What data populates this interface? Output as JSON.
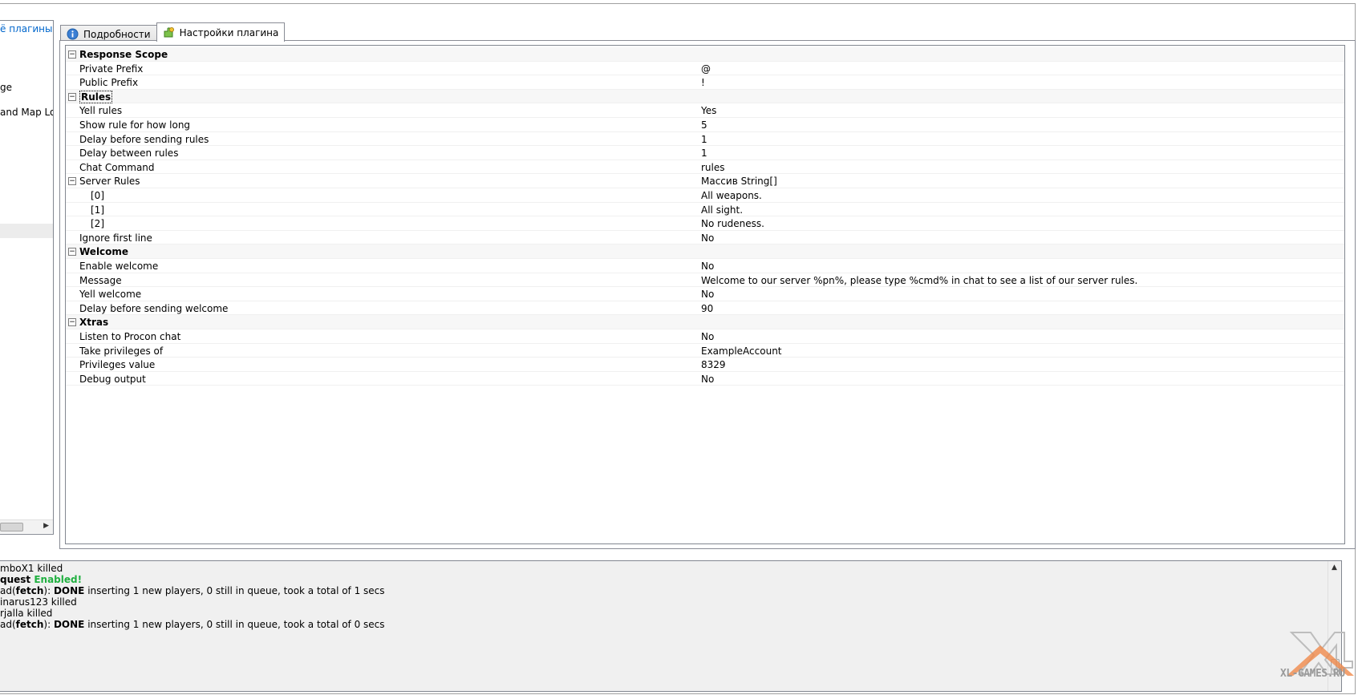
{
  "left_panel": {
    "link": "ё плагины",
    "items": [
      "ge",
      "and Map Lo"
    ]
  },
  "tabs": [
    {
      "label": "Подробности",
      "icon": "info-icon",
      "active": false
    },
    {
      "label": "Настройки плагина",
      "icon": "plugin-settings-icon",
      "active": true
    }
  ],
  "properties": {
    "rows": [
      {
        "type": "cat",
        "name": "Response Scope",
        "value": ""
      },
      {
        "type": "prop",
        "name": "Private Prefix",
        "value": "@"
      },
      {
        "type": "prop",
        "name": "Public Prefix",
        "value": "!"
      },
      {
        "type": "cat",
        "name": "Rules",
        "value": "",
        "focused": true
      },
      {
        "type": "prop",
        "name": "Yell rules",
        "value": "Yes"
      },
      {
        "type": "prop",
        "name": "Show rule for how long",
        "value": "5"
      },
      {
        "type": "prop",
        "name": "Delay before sending rules",
        "value": "1"
      },
      {
        "type": "prop",
        "name": "Delay between rules",
        "value": "1"
      },
      {
        "type": "prop",
        "name": "Chat Command",
        "value": "rules"
      },
      {
        "type": "expand",
        "name": "Server Rules",
        "value": "Массив String[]"
      },
      {
        "type": "child",
        "name": "[0]",
        "value": "All weapons."
      },
      {
        "type": "child",
        "name": "[1]",
        "value": "All sight."
      },
      {
        "type": "child",
        "name": "[2]",
        "value": "No rudeness."
      },
      {
        "type": "prop",
        "name": "Ignore first line",
        "value": "No"
      },
      {
        "type": "cat",
        "name": "Welcome",
        "value": ""
      },
      {
        "type": "prop",
        "name": "Enable welcome",
        "value": "No"
      },
      {
        "type": "prop",
        "name": "Message",
        "value": "Welcome to our server %pn%, please type %cmd% in chat to see a list of our server rules."
      },
      {
        "type": "prop",
        "name": "Yell welcome",
        "value": "No"
      },
      {
        "type": "prop",
        "name": "Delay before sending welcome",
        "value": "90"
      },
      {
        "type": "cat",
        "name": "Xtras",
        "value": ""
      },
      {
        "type": "prop",
        "name": "Listen to Procon chat",
        "value": "No"
      },
      {
        "type": "prop",
        "name": "Take privileges of",
        "value": "ExampleAccount"
      },
      {
        "type": "prop",
        "name": "Privileges value",
        "value": "8329"
      },
      {
        "type": "prop",
        "name": "Debug output",
        "value": "No"
      }
    ]
  },
  "log": {
    "lines": [
      [
        {
          "t": "mboX1 killed",
          "s": ""
        }
      ],
      [
        {
          "t": "quest ",
          "s": "b"
        },
        {
          "t": "Enabled!",
          "s": "g"
        }
      ],
      [
        {
          "t": "ad(",
          "s": ""
        },
        {
          "t": "fetch",
          "s": "b"
        },
        {
          "t": "): ",
          "s": ""
        },
        {
          "t": "DONE",
          "s": "b"
        },
        {
          "t": " inserting 1 new players, 0 still in queue, took a total of 1 secs",
          "s": ""
        }
      ],
      [
        {
          "t": "inarus123 killed",
          "s": ""
        }
      ],
      [
        {
          "t": "rjalla killed",
          "s": ""
        }
      ],
      [
        {
          "t": "ad(",
          "s": ""
        },
        {
          "t": "fetch",
          "s": "b"
        },
        {
          "t": "): ",
          "s": ""
        },
        {
          "t": "DONE",
          "s": "b"
        },
        {
          "t": " inserting 1 new players, 0 still in queue, took a total of 0 secs",
          "s": ""
        }
      ]
    ]
  },
  "watermark": {
    "text": "XL-GAMES.RU"
  },
  "colors": {
    "link": "#0066cc",
    "enabled": "#20b040",
    "log_bg": "#f0f0f0",
    "border": "#828790"
  }
}
